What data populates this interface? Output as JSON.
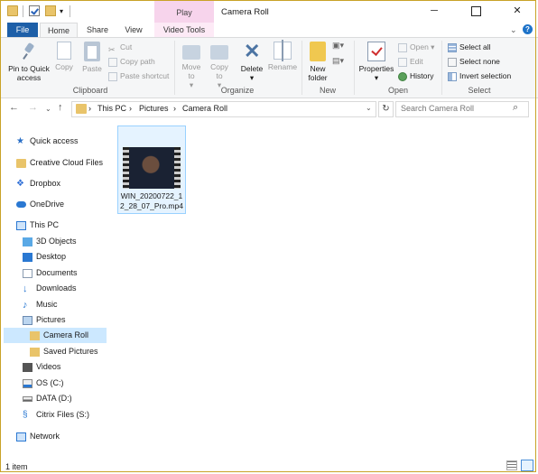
{
  "window": {
    "title": "Camera Roll",
    "context_tab": "Play"
  },
  "tabs": {
    "file": "File",
    "home": "Home",
    "share": "Share",
    "view": "View",
    "video_tools": "Video Tools"
  },
  "ribbon": {
    "clipboard": {
      "label": "Clipboard",
      "pin": "Pin to Quick access",
      "copy": "Copy",
      "paste": "Paste",
      "cut": "Cut",
      "copy_path": "Copy path",
      "paste_shortcut": "Paste shortcut"
    },
    "organize": {
      "label": "Organize",
      "move_to": "Move to",
      "copy_to": "Copy to",
      "delete": "Delete",
      "rename": "Rename"
    },
    "new": {
      "label": "New",
      "new_folder": "New folder"
    },
    "open": {
      "label": "Open",
      "properties": "Properties",
      "open": "Open",
      "edit": "Edit",
      "history": "History"
    },
    "select": {
      "label": "Select",
      "select_all": "Select all",
      "select_none": "Select none",
      "invert": "Invert selection"
    }
  },
  "address": {
    "crumbs": [
      "This PC",
      "Pictures",
      "Camera Roll"
    ],
    "search_placeholder": "Search Camera Roll"
  },
  "sidebar": [
    {
      "label": "Quick access",
      "icon": "star-icon"
    },
    {
      "label": "Creative Cloud Files",
      "icon": "creative-cloud-icon"
    },
    {
      "label": "Dropbox",
      "icon": "dropbox-icon"
    },
    {
      "label": "OneDrive",
      "icon": "cloud-icon"
    },
    {
      "label": "This PC",
      "icon": "computer-icon"
    },
    {
      "label": "3D Objects",
      "icon": "cube-icon"
    },
    {
      "label": "Desktop",
      "icon": "desktop-icon"
    },
    {
      "label": "Documents",
      "icon": "document-icon"
    },
    {
      "label": "Downloads",
      "icon": "download-icon"
    },
    {
      "label": "Music",
      "icon": "music-icon"
    },
    {
      "label": "Pictures",
      "icon": "pictures-icon"
    },
    {
      "label": "Camera Roll",
      "icon": "folder-icon"
    },
    {
      "label": "Saved Pictures",
      "icon": "folder-icon"
    },
    {
      "label": "Videos",
      "icon": "video-icon"
    },
    {
      "label": "OS (C:)",
      "icon": "drive-icon"
    },
    {
      "label": "DATA (D:)",
      "icon": "drive-icon"
    },
    {
      "label": "Citrix Files (S:)",
      "icon": "citrix-icon"
    },
    {
      "label": "Network",
      "icon": "network-icon"
    }
  ],
  "files": [
    {
      "name": "WIN_20200722_12_28_07_Pro.mp4"
    }
  ],
  "status": {
    "item_count": "1 item"
  }
}
